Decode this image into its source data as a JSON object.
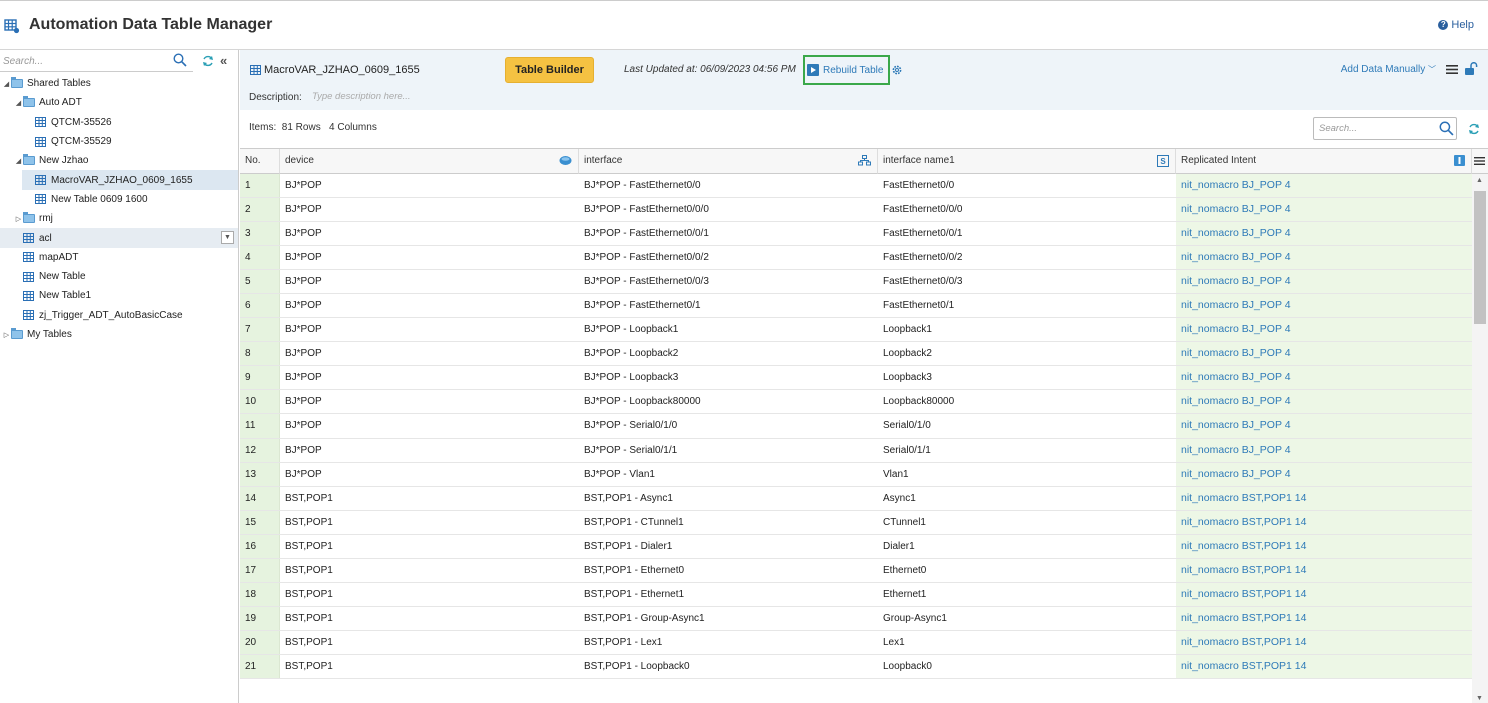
{
  "app": {
    "title": "Automation Data Table Manager",
    "help": "Help"
  },
  "sidebar": {
    "search_placeholder": "Search...",
    "tree": [
      {
        "label": "Shared Tables",
        "type": "folder",
        "level": 0,
        "expanded": true
      },
      {
        "label": "Auto ADT",
        "type": "folder",
        "level": 1,
        "expanded": true
      },
      {
        "label": "QTCM-35526",
        "type": "table",
        "level": 2
      },
      {
        "label": "QTCM-35529",
        "type": "table",
        "level": 2
      },
      {
        "label": "New Jzhao",
        "type": "folder",
        "level": 1,
        "expanded": true
      },
      {
        "label": "MacroVAR_JZHAO_0609_1655",
        "type": "table",
        "level": 2,
        "selected": true
      },
      {
        "label": "New Table 0609 1600",
        "type": "table",
        "level": 2
      },
      {
        "label": "rmj",
        "type": "folder",
        "level": 1,
        "expanded": false
      },
      {
        "label": "acl",
        "type": "table",
        "level": 1,
        "hover": true
      },
      {
        "label": "mapADT",
        "type": "table",
        "level": 1
      },
      {
        "label": "New Table",
        "type": "table",
        "level": 1
      },
      {
        "label": "New Table1",
        "type": "table",
        "level": 1
      },
      {
        "label": "zj_Trigger_ADT_AutoBasicCase",
        "type": "table",
        "level": 1
      },
      {
        "label": "My Tables",
        "type": "folder",
        "level": 0,
        "expanded": false
      }
    ]
  },
  "toolbar": {
    "table_name": "MacroVAR_JZHAO_0609_1655",
    "table_builder": "Table Builder",
    "last_updated": "Last Updated at: 06/09/2023 04:56 PM",
    "rebuild": "Rebuild Table",
    "add_data": "Add Data Manually",
    "description_label": "Description:",
    "description_placeholder": "Type description here...",
    "items": "Items:  81 Rows   4 Columns",
    "search_placeholder": "Search..."
  },
  "grid": {
    "columns": [
      "No.",
      "device",
      "interface",
      "interface name1",
      "Replicated Intent"
    ],
    "rows": [
      [
        "1",
        "BJ*POP",
        "BJ*POP - FastEthernet0/0",
        "FastEthernet0/0",
        "nit_nomacro BJ_POP 4"
      ],
      [
        "2",
        "BJ*POP",
        "BJ*POP - FastEthernet0/0/0",
        "FastEthernet0/0/0",
        "nit_nomacro BJ_POP 4"
      ],
      [
        "3",
        "BJ*POP",
        "BJ*POP - FastEthernet0/0/1",
        "FastEthernet0/0/1",
        "nit_nomacro BJ_POP 4"
      ],
      [
        "4",
        "BJ*POP",
        "BJ*POP - FastEthernet0/0/2",
        "FastEthernet0/0/2",
        "nit_nomacro BJ_POP 4"
      ],
      [
        "5",
        "BJ*POP",
        "BJ*POP - FastEthernet0/0/3",
        "FastEthernet0/0/3",
        "nit_nomacro BJ_POP 4"
      ],
      [
        "6",
        "BJ*POP",
        "BJ*POP - FastEthernet0/1",
        "FastEthernet0/1",
        "nit_nomacro BJ_POP 4"
      ],
      [
        "7",
        "BJ*POP",
        "BJ*POP - Loopback1",
        "Loopback1",
        "nit_nomacro BJ_POP 4"
      ],
      [
        "8",
        "BJ*POP",
        "BJ*POP - Loopback2",
        "Loopback2",
        "nit_nomacro BJ_POP 4"
      ],
      [
        "9",
        "BJ*POP",
        "BJ*POP - Loopback3",
        "Loopback3",
        "nit_nomacro BJ_POP 4"
      ],
      [
        "10",
        "BJ*POP",
        "BJ*POP - Loopback80000",
        "Loopback80000",
        "nit_nomacro BJ_POP 4"
      ],
      [
        "11",
        "BJ*POP",
        "BJ*POP - Serial0/1/0",
        "Serial0/1/0",
        "nit_nomacro BJ_POP 4"
      ],
      [
        "12",
        "BJ*POP",
        "BJ*POP - Serial0/1/1",
        "Serial0/1/1",
        "nit_nomacro BJ_POP 4"
      ],
      [
        "13",
        "BJ*POP",
        "BJ*POP - Vlan1",
        "Vlan1",
        "nit_nomacro BJ_POP 4"
      ],
      [
        "14",
        "BST,POP1",
        "BST,POP1 - Async1",
        "Async1",
        "nit_nomacro BST,POP1 14"
      ],
      [
        "15",
        "BST,POP1",
        "BST,POP1 - CTunnel1",
        "CTunnel1",
        "nit_nomacro BST,POP1 14"
      ],
      [
        "16",
        "BST,POP1",
        "BST,POP1 - Dialer1",
        "Dialer1",
        "nit_nomacro BST,POP1 14"
      ],
      [
        "17",
        "BST,POP1",
        "BST,POP1 - Ethernet0",
        "Ethernet0",
        "nit_nomacro BST,POP1 14"
      ],
      [
        "18",
        "BST,POP1",
        "BST,POP1 - Ethernet1",
        "Ethernet1",
        "nit_nomacro BST,POP1 14"
      ],
      [
        "19",
        "BST,POP1",
        "BST,POP1 - Group-Async1",
        "Group-Async1",
        "nit_nomacro BST,POP1 14"
      ],
      [
        "20",
        "BST,POP1",
        "BST,POP1 - Lex1",
        "Lex1",
        "nit_nomacro BST,POP1 14"
      ],
      [
        "21",
        "BST,POP1",
        "BST,POP1 - Loopback0",
        "Loopback0",
        "nit_nomacro BST,POP1 14"
      ]
    ]
  },
  "colors": {
    "accent": "#2e7ab8",
    "builder": "#f5c242",
    "rebuild_outline": "#3aa84a",
    "row_green": "#e6f3df"
  }
}
